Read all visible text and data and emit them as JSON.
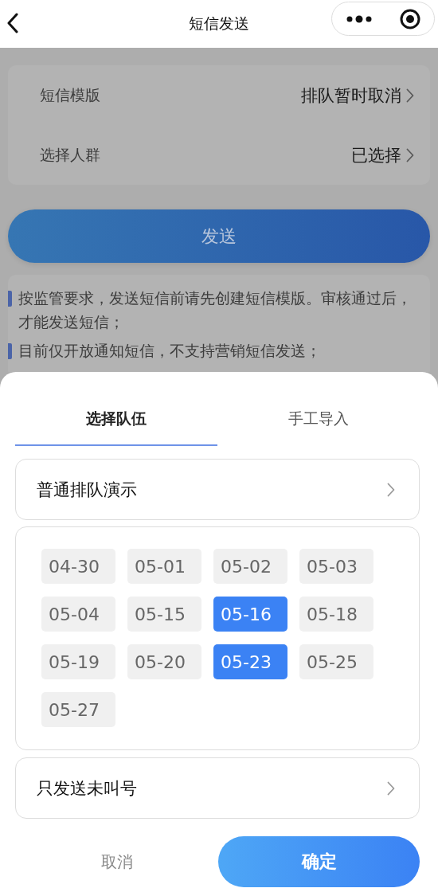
{
  "nav": {
    "title": "短信发送"
  },
  "form_rows": [
    {
      "label": "短信模版",
      "value": "排队暂时取消"
    },
    {
      "label": "选择人群",
      "value": "已选择"
    }
  ],
  "send_button": "发送",
  "notes": [
    "按监管要求，发送短信前请先创建短信模版。审核通过后，才能发送短信；",
    "目前仅开放通知短信，不支持营销短信发送；"
  ],
  "sheet": {
    "tabs": [
      {
        "label": "选择队伍",
        "selected": true
      },
      {
        "label": "手工导入",
        "selected": false
      }
    ],
    "team": "普通排队演示",
    "dates": [
      {
        "label": "04-30",
        "selected": false
      },
      {
        "label": "05-01",
        "selected": false
      },
      {
        "label": "05-02",
        "selected": false
      },
      {
        "label": "05-03",
        "selected": false
      },
      {
        "label": "05-04",
        "selected": false
      },
      {
        "label": "05-15",
        "selected": false
      },
      {
        "label": "05-16",
        "selected": true
      },
      {
        "label": "05-18",
        "selected": false
      },
      {
        "label": "05-19",
        "selected": false
      },
      {
        "label": "05-20",
        "selected": false
      },
      {
        "label": "05-23",
        "selected": true
      },
      {
        "label": "05-25",
        "selected": false
      },
      {
        "label": "05-27",
        "selected": false
      }
    ],
    "filter": "只发送未叫号",
    "cancel": "取消",
    "confirm": "确定"
  }
}
